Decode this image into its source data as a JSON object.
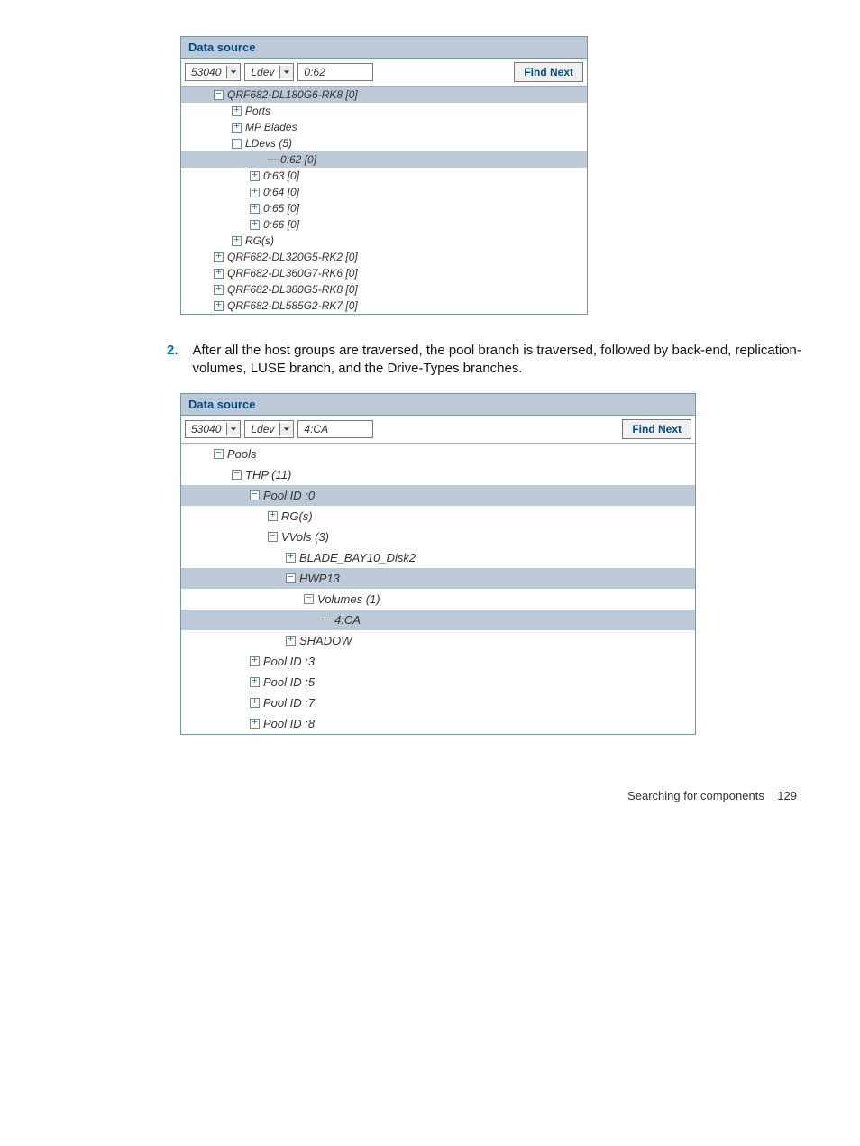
{
  "panel1": {
    "title": "Data source",
    "combo1": "53040",
    "combo2": "Ldev",
    "search": "0:62",
    "find_label": "Find Next",
    "tree": {
      "root": "QRF682-DL180G6-RK8 [0]",
      "n_ports": "Ports",
      "n_mp": "MP Blades",
      "n_ldevs": "LDevs (5)",
      "l0": "0:62 [0]",
      "l1": "0:63 [0]",
      "l2": "0:64 [0]",
      "l3": "0:65 [0]",
      "l4": "0:66 [0]",
      "rg": "RG(s)",
      "s1": "QRF682-DL320G5-RK2 [0]",
      "s2": "QRF682-DL360G7-RK6 [0]",
      "s3": "QRF682-DL380G5-RK8 [0]",
      "s4": "QRF682-DL585G2-RK7 [0]"
    }
  },
  "step2": {
    "num": "2.",
    "text": "After all the host groups are traversed, the pool branch is traversed, followed by back-end, replication-volumes, LUSE branch, and the Drive-Types branches."
  },
  "panel2": {
    "title": "Data source",
    "combo1": "53040",
    "combo2": "Ldev",
    "search": "4:CA",
    "find_label": "Find Next",
    "tree": {
      "pools": "Pools",
      "thp": "THP (11)",
      "pool0": "Pool ID :0",
      "rg": "RG(s)",
      "vvols": "VVols (3)",
      "blade": "BLADE_BAY10_Disk2",
      "hwp": "HWP13",
      "volumes": "Volumes (1)",
      "v0": "4:CA",
      "shadow": "SHADOW",
      "pool3": "Pool ID :3",
      "pool5": "Pool ID :5",
      "pool7": "Pool ID :7",
      "pool8": "Pool ID :8"
    }
  },
  "footer": {
    "title": "Searching for components",
    "page": "129"
  }
}
